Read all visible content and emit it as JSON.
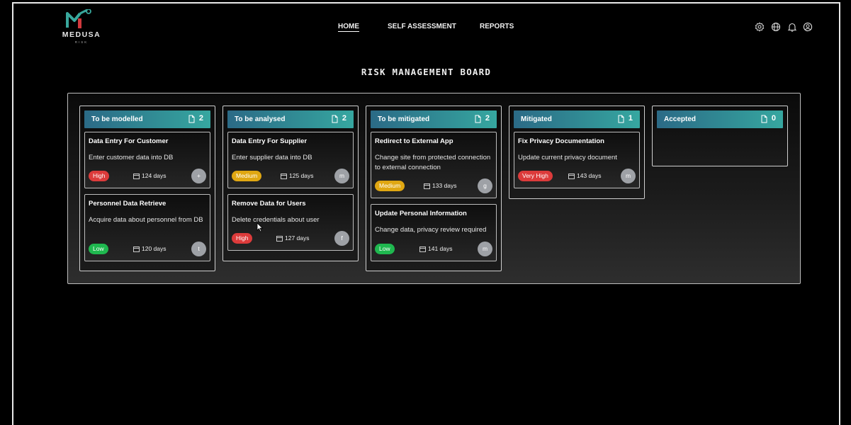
{
  "brand": {
    "name": "MEDUSA",
    "sub": "RISK"
  },
  "nav": {
    "home": "HOME",
    "self_assessment": "SELF ASSESSMENT",
    "reports": "REPORTS"
  },
  "header_icons": [
    "gear-icon",
    "globe-icon",
    "bell-icon",
    "user-icon"
  ],
  "board_title": "RISK MANAGEMENT BOARD",
  "colors": {
    "accent_gradient": [
      "#2b6a86",
      "#36a7a0"
    ],
    "high": "#dc3b3b",
    "medium": "#e0a712",
    "low": "#1fb84f"
  },
  "columns": [
    {
      "title": "To be modelled",
      "count": "2",
      "cards": [
        {
          "title": "Data Entry For Customer",
          "description": "Enter customer data into DB",
          "priority": "High",
          "days": "124 days",
          "avatar": "+"
        },
        {
          "title": "Personnel Data Retrieve",
          "description": "Acquire data about personnel from DB",
          "priority": "Low",
          "days": "120 days",
          "avatar": "t"
        }
      ]
    },
    {
      "title": "To be analysed",
      "count": "2",
      "cards": [
        {
          "title": "Data Entry For Supplier",
          "description": "Enter supplier data into DB",
          "priority": "Medium",
          "days": "125 days",
          "avatar": "m"
        },
        {
          "title": "Remove Data for Users",
          "description": "Delete credentials about user",
          "priority": "High",
          "days": "127 days",
          "avatar": "f"
        }
      ]
    },
    {
      "title": "To be mitigated",
      "count": "2",
      "cards": [
        {
          "title": "Redirect to External App",
          "description": "Change site from protected connection to external connection",
          "priority": "Medium",
          "days": "133 days",
          "avatar": "g"
        },
        {
          "title": "Update Personal Information",
          "description": "Change data, privacy review required",
          "priority": "Low",
          "days": "141 days",
          "avatar": "m"
        }
      ]
    },
    {
      "title": "Mitigated",
      "count": "1",
      "cards": [
        {
          "title": "Fix Privacy Documentation",
          "description": "Update current privacy document",
          "priority": "Very High",
          "days": "143 days",
          "avatar": "m"
        }
      ]
    },
    {
      "title": "Accepted",
      "count": "0",
      "cards": []
    }
  ]
}
